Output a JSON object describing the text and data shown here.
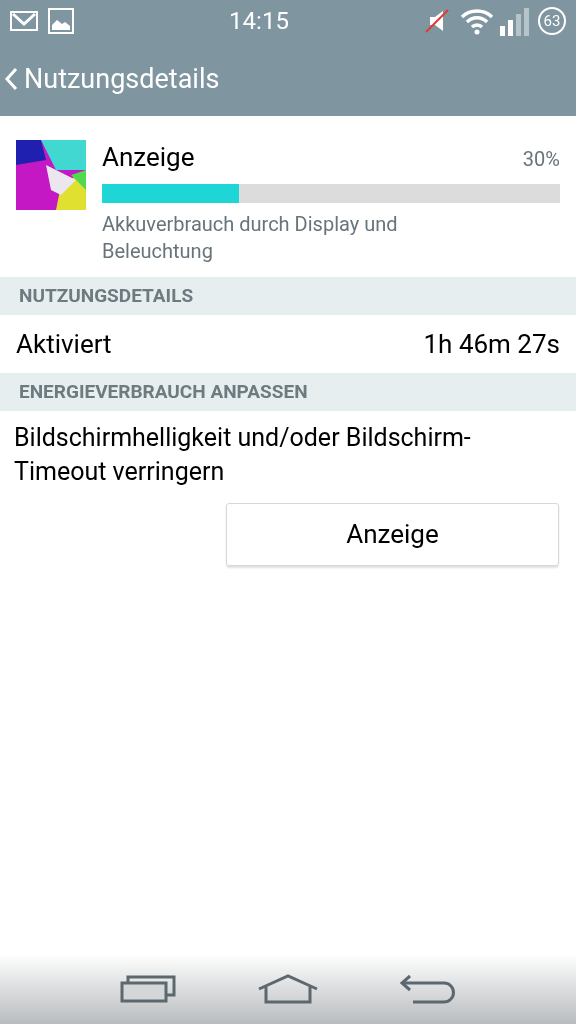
{
  "status_bar": {
    "time": "14:15",
    "battery": "63"
  },
  "app_bar": {
    "title": "Nutzungsdetails"
  },
  "usage_item": {
    "title": "Anzeige",
    "percent": "30%",
    "level": 0.3,
    "description": "Akkuverbrauch durch Display und Beleuchtung"
  },
  "sections": [
    {
      "header": "NUTZUNGSDETAILS",
      "kind": "row",
      "label": "Aktiviert",
      "value": "1h 46m 27s"
    },
    {
      "header": "ENERGIEVERBRAUCH ANPASSEN",
      "kind": "action",
      "text": "Bildschirmhelligkeit und/oder Bildschirm-Timeout verringern",
      "button": "Anzeige"
    }
  ]
}
